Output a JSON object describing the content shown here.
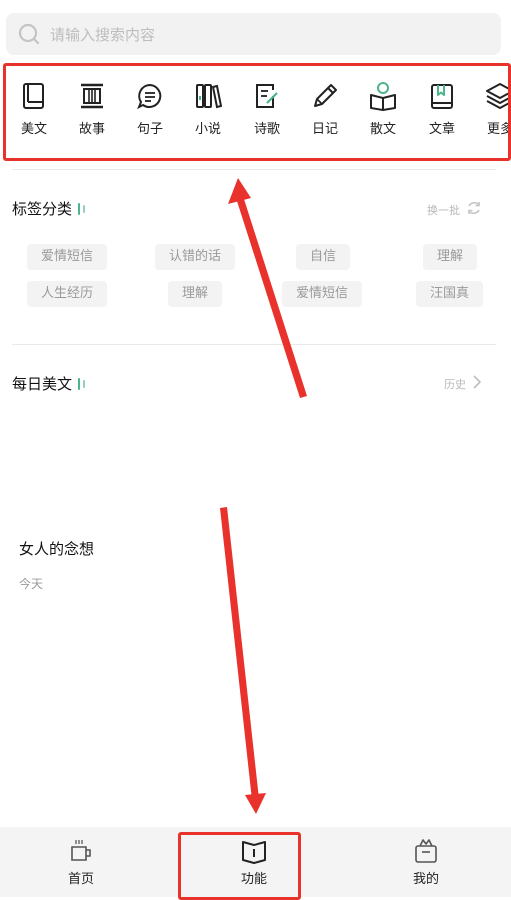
{
  "search": {
    "placeholder": "请输入搜索内容",
    "icon": "search-icon"
  },
  "categories": [
    {
      "label": "美文",
      "icon": "book-icon"
    },
    {
      "label": "故事",
      "icon": "scroll-icon"
    },
    {
      "label": "句子",
      "icon": "chat-bubble-icon"
    },
    {
      "label": "小说",
      "icon": "books-icon"
    },
    {
      "label": "诗歌",
      "icon": "note-edit-icon"
    },
    {
      "label": "日记",
      "icon": "pencil-icon"
    },
    {
      "label": "散文",
      "icon": "reading-icon"
    },
    {
      "label": "文章",
      "icon": "bookmark-book-icon"
    },
    {
      "label": "更多",
      "icon": "layers-icon"
    }
  ],
  "tags_section": {
    "title": "标签分类",
    "refresh_label": "换一批",
    "tags": [
      "爱情短信",
      "认错的话",
      "自信",
      "理解",
      "人生经历",
      "理解",
      "爱情短信",
      "汪国真"
    ]
  },
  "daily_section": {
    "title": "每日美文",
    "history_label": "历史",
    "article": {
      "title": "女人的念想",
      "date": "今天"
    }
  },
  "bottom_nav": [
    {
      "label": "首页",
      "icon": "coffee-cup-icon"
    },
    {
      "label": "功能",
      "icon": "open-book-icon"
    },
    {
      "label": "我的",
      "icon": "gift-box-icon"
    }
  ],
  "colors": {
    "accent_green": "#4cb58a",
    "annotation_red": "#e8322b",
    "search_bg": "#f2f2f3",
    "nav_bg": "#f4f4f4",
    "chip_bg": "#f3f3f3"
  }
}
